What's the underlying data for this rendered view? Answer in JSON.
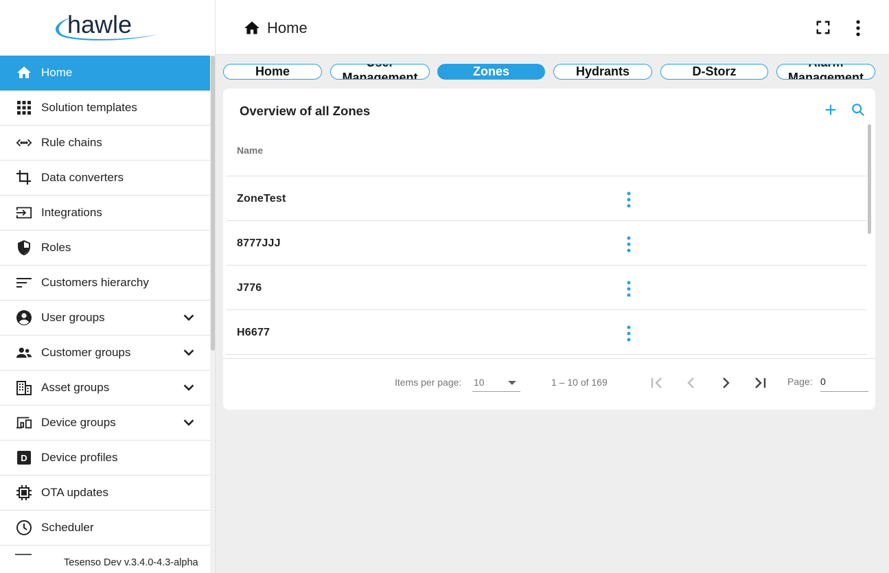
{
  "brand": {
    "logo_text": "hawle",
    "accent": "#29a0e1"
  },
  "sidebar": {
    "items": [
      {
        "label": "Home",
        "icon": "home-icon",
        "active": true
      },
      {
        "label": "Solution templates",
        "icon": "grid-icon"
      },
      {
        "label": "Rule chains",
        "icon": "code-arrows-icon"
      },
      {
        "label": "Data converters",
        "icon": "crop-icon"
      },
      {
        "label": "Integrations",
        "icon": "input-icon"
      },
      {
        "label": "Roles",
        "icon": "shield-icon"
      },
      {
        "label": "Customers hierarchy",
        "icon": "sort-lines-icon"
      },
      {
        "label": "User groups",
        "icon": "account-circle-icon",
        "expandable": true
      },
      {
        "label": "Customer groups",
        "icon": "people-icon",
        "expandable": true
      },
      {
        "label": "Asset groups",
        "icon": "building-icon",
        "expandable": true
      },
      {
        "label": "Device groups",
        "icon": "devices-icon",
        "expandable": true
      },
      {
        "label": "Device profiles",
        "icon": "device-profile-icon"
      },
      {
        "label": "OTA updates",
        "icon": "chip-icon"
      },
      {
        "label": "Scheduler",
        "icon": "clock-icon"
      }
    ],
    "version": "Tesenso Dev v.3.4.0-4.3-alpha"
  },
  "topbar": {
    "title": "Home"
  },
  "tabs": [
    {
      "label": "Home"
    },
    {
      "label": "User Management"
    },
    {
      "label": "Zones",
      "active": true
    },
    {
      "label": "Hydrants"
    },
    {
      "label": "D-Storz"
    },
    {
      "label": "Alarm Management"
    }
  ],
  "card": {
    "title": "Overview of all Zones",
    "column_name": "Name",
    "rows": [
      "ZoneTest",
      "8777JJJ",
      "J776",
      "H6677"
    ]
  },
  "paginator": {
    "items_per_page_label": "Items per page:",
    "items_per_page_value": "10",
    "range_label": "1 – 10 of 169",
    "page_label": "Page:",
    "page_value": "0"
  }
}
